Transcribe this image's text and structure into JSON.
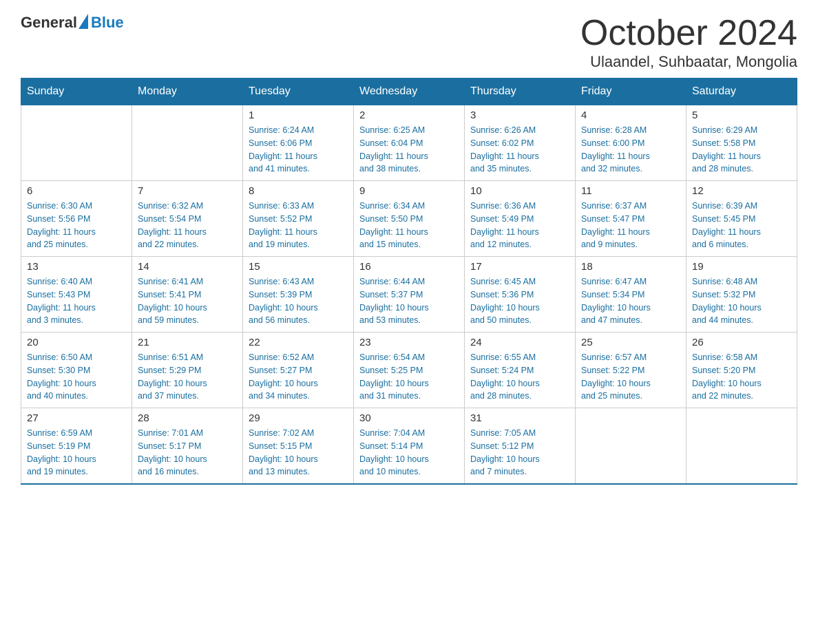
{
  "header": {
    "logo": {
      "general": "General",
      "blue": "Blue"
    },
    "title": "October 2024",
    "subtitle": "Ulaandel, Suhbaatar, Mongolia"
  },
  "weekdays": [
    "Sunday",
    "Monday",
    "Tuesday",
    "Wednesday",
    "Thursday",
    "Friday",
    "Saturday"
  ],
  "weeks": [
    [
      {
        "day": "",
        "info": ""
      },
      {
        "day": "",
        "info": ""
      },
      {
        "day": "1",
        "info": "Sunrise: 6:24 AM\nSunset: 6:06 PM\nDaylight: 11 hours\nand 41 minutes."
      },
      {
        "day": "2",
        "info": "Sunrise: 6:25 AM\nSunset: 6:04 PM\nDaylight: 11 hours\nand 38 minutes."
      },
      {
        "day": "3",
        "info": "Sunrise: 6:26 AM\nSunset: 6:02 PM\nDaylight: 11 hours\nand 35 minutes."
      },
      {
        "day": "4",
        "info": "Sunrise: 6:28 AM\nSunset: 6:00 PM\nDaylight: 11 hours\nand 32 minutes."
      },
      {
        "day": "5",
        "info": "Sunrise: 6:29 AM\nSunset: 5:58 PM\nDaylight: 11 hours\nand 28 minutes."
      }
    ],
    [
      {
        "day": "6",
        "info": "Sunrise: 6:30 AM\nSunset: 5:56 PM\nDaylight: 11 hours\nand 25 minutes."
      },
      {
        "day": "7",
        "info": "Sunrise: 6:32 AM\nSunset: 5:54 PM\nDaylight: 11 hours\nand 22 minutes."
      },
      {
        "day": "8",
        "info": "Sunrise: 6:33 AM\nSunset: 5:52 PM\nDaylight: 11 hours\nand 19 minutes."
      },
      {
        "day": "9",
        "info": "Sunrise: 6:34 AM\nSunset: 5:50 PM\nDaylight: 11 hours\nand 15 minutes."
      },
      {
        "day": "10",
        "info": "Sunrise: 6:36 AM\nSunset: 5:49 PM\nDaylight: 11 hours\nand 12 minutes."
      },
      {
        "day": "11",
        "info": "Sunrise: 6:37 AM\nSunset: 5:47 PM\nDaylight: 11 hours\nand 9 minutes."
      },
      {
        "day": "12",
        "info": "Sunrise: 6:39 AM\nSunset: 5:45 PM\nDaylight: 11 hours\nand 6 minutes."
      }
    ],
    [
      {
        "day": "13",
        "info": "Sunrise: 6:40 AM\nSunset: 5:43 PM\nDaylight: 11 hours\nand 3 minutes."
      },
      {
        "day": "14",
        "info": "Sunrise: 6:41 AM\nSunset: 5:41 PM\nDaylight: 10 hours\nand 59 minutes."
      },
      {
        "day": "15",
        "info": "Sunrise: 6:43 AM\nSunset: 5:39 PM\nDaylight: 10 hours\nand 56 minutes."
      },
      {
        "day": "16",
        "info": "Sunrise: 6:44 AM\nSunset: 5:37 PM\nDaylight: 10 hours\nand 53 minutes."
      },
      {
        "day": "17",
        "info": "Sunrise: 6:45 AM\nSunset: 5:36 PM\nDaylight: 10 hours\nand 50 minutes."
      },
      {
        "day": "18",
        "info": "Sunrise: 6:47 AM\nSunset: 5:34 PM\nDaylight: 10 hours\nand 47 minutes."
      },
      {
        "day": "19",
        "info": "Sunrise: 6:48 AM\nSunset: 5:32 PM\nDaylight: 10 hours\nand 44 minutes."
      }
    ],
    [
      {
        "day": "20",
        "info": "Sunrise: 6:50 AM\nSunset: 5:30 PM\nDaylight: 10 hours\nand 40 minutes."
      },
      {
        "day": "21",
        "info": "Sunrise: 6:51 AM\nSunset: 5:29 PM\nDaylight: 10 hours\nand 37 minutes."
      },
      {
        "day": "22",
        "info": "Sunrise: 6:52 AM\nSunset: 5:27 PM\nDaylight: 10 hours\nand 34 minutes."
      },
      {
        "day": "23",
        "info": "Sunrise: 6:54 AM\nSunset: 5:25 PM\nDaylight: 10 hours\nand 31 minutes."
      },
      {
        "day": "24",
        "info": "Sunrise: 6:55 AM\nSunset: 5:24 PM\nDaylight: 10 hours\nand 28 minutes."
      },
      {
        "day": "25",
        "info": "Sunrise: 6:57 AM\nSunset: 5:22 PM\nDaylight: 10 hours\nand 25 minutes."
      },
      {
        "day": "26",
        "info": "Sunrise: 6:58 AM\nSunset: 5:20 PM\nDaylight: 10 hours\nand 22 minutes."
      }
    ],
    [
      {
        "day": "27",
        "info": "Sunrise: 6:59 AM\nSunset: 5:19 PM\nDaylight: 10 hours\nand 19 minutes."
      },
      {
        "day": "28",
        "info": "Sunrise: 7:01 AM\nSunset: 5:17 PM\nDaylight: 10 hours\nand 16 minutes."
      },
      {
        "day": "29",
        "info": "Sunrise: 7:02 AM\nSunset: 5:15 PM\nDaylight: 10 hours\nand 13 minutes."
      },
      {
        "day": "30",
        "info": "Sunrise: 7:04 AM\nSunset: 5:14 PM\nDaylight: 10 hours\nand 10 minutes."
      },
      {
        "day": "31",
        "info": "Sunrise: 7:05 AM\nSunset: 5:12 PM\nDaylight: 10 hours\nand 7 minutes."
      },
      {
        "day": "",
        "info": ""
      },
      {
        "day": "",
        "info": ""
      }
    ]
  ]
}
